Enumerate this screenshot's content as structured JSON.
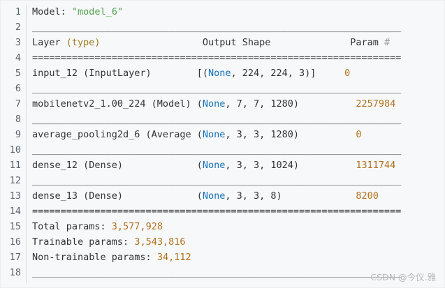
{
  "line_numbers": [
    "1",
    "2",
    "3",
    "4",
    "5",
    "6",
    "7",
    "8",
    "9",
    "10",
    "11",
    "12",
    "13",
    "14",
    "15",
    "16",
    "17",
    "18"
  ],
  "model_label": "Model:",
  "model_name": "\"model_6\"",
  "rule_underscore": "_________________________________________________________________",
  "rule_equals": "=================================================================",
  "header": {
    "layer": "Layer",
    "type": "(type)",
    "output_shape": "Output Shape",
    "param": "Param",
    "hash": "#"
  },
  "rows": [
    {
      "layer": "input_12 (InputLayer)",
      "open": "[(",
      "none": "None",
      "rest": ", 224, 224, 3)]",
      "param": "0"
    },
    {
      "layer": "mobilenetv2_1.00_224 (Model)",
      "open": "(",
      "none": "None",
      "rest": ", 7, 7, 1280)",
      "param": "2257984"
    },
    {
      "layer": "average_pooling2d_6 (Average",
      "open": "(",
      "none": "None",
      "rest": ", 3, 3, 1280)",
      "param": "0"
    },
    {
      "layer": "dense_12 (Dense)",
      "open": "(",
      "none": "None",
      "rest": ", 3, 3, 1024)",
      "param": "1311744"
    },
    {
      "layer": "dense_13 (Dense)",
      "open": "(",
      "none": "None",
      "rest": ", 3, 3, 8)",
      "param": "8200"
    }
  ],
  "totals": {
    "total_label": "Total params: ",
    "total_value": "3,577,928",
    "trainable_label": "Trainable params: ",
    "trainable_value": "3,543,816",
    "nontrainable_label": "Non-trainable params: ",
    "nontrainable_value": "34,112"
  },
  "watermark": "CSDN @今仪.雅"
}
